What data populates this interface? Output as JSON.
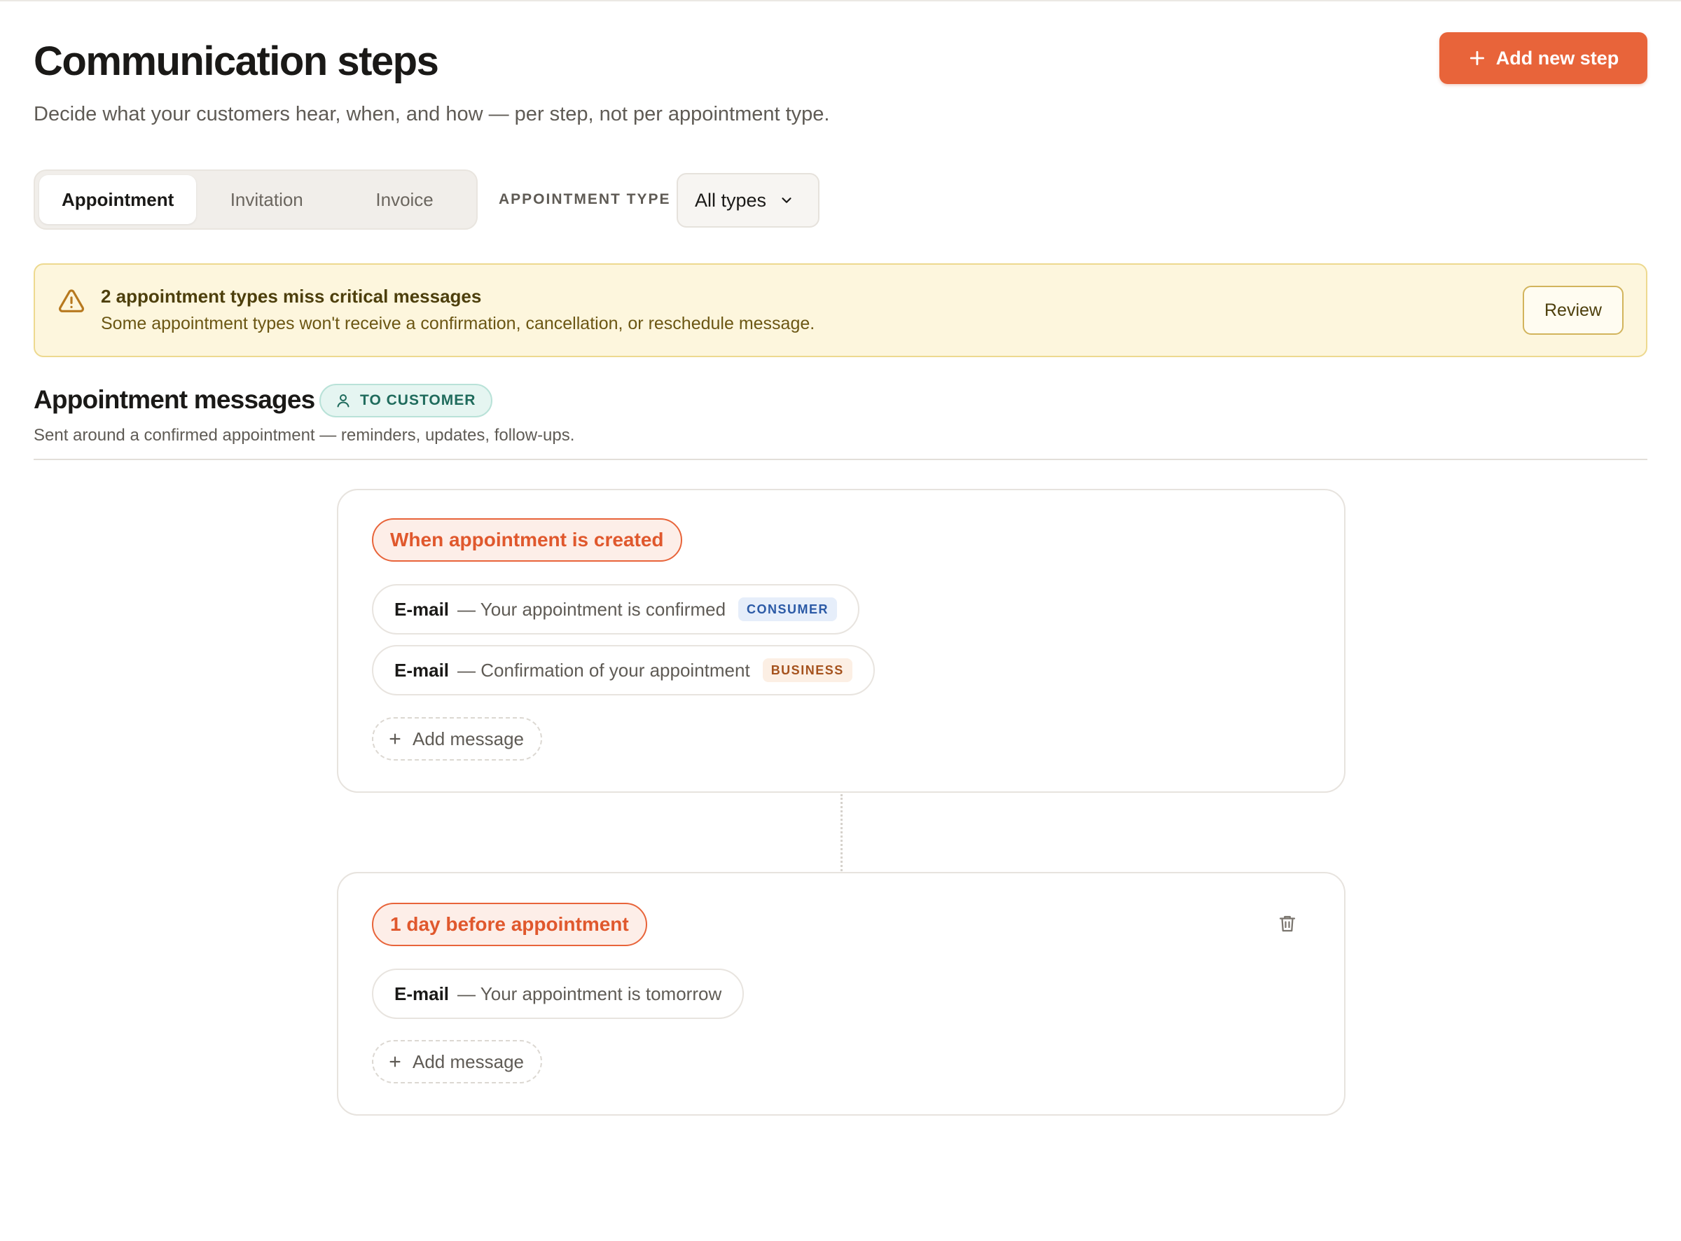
{
  "header": {
    "title": "Communication steps",
    "subtitle": "Decide what your customers hear, when, and how — per step, not per appointment type.",
    "add_step_label": "Add new step"
  },
  "tabs": [
    {
      "label": "Appointment",
      "active": true
    },
    {
      "label": "Invitation",
      "active": false
    },
    {
      "label": "Invoice",
      "active": false
    }
  ],
  "filter": {
    "label": "APPOINTMENT TYPE",
    "value": "All types"
  },
  "banner": {
    "title": "2 appointment types miss critical messages",
    "text": "Some appointment types won't receive a confirmation, cancellation, or reschedule message.",
    "action_label": "Review"
  },
  "section": {
    "title": "Appointment messages",
    "audience": "TO CUSTOMER",
    "description": "Sent around a confirmed appointment — reminders, updates, follow-ups."
  },
  "steps": [
    {
      "trigger": "When appointment is created",
      "messages": [
        {
          "channel": "E-mail",
          "subject": "— Your appointment is confirmed",
          "audience": "CONSUMER"
        },
        {
          "channel": "E-mail",
          "subject": "— Confirmation of your appointment",
          "audience": "BUSINESS"
        }
      ],
      "add_label": "Add message"
    },
    {
      "trigger": "1 day before appointment",
      "messages": [
        {
          "channel": "E-mail",
          "subject": "— Your appointment is tomorrow"
        }
      ],
      "add_label": "Add message"
    }
  ],
  "colors": {
    "accent": "#e8643a",
    "warning_bg": "#fdf6dd",
    "warning_border": "#edd98f",
    "audience_badge": "#1f6b5c",
    "consumer_tag": "#2b5aa6",
    "business_tag": "#a5521d"
  },
  "icons": [
    "plus-icon",
    "chevron-down-icon",
    "warning-triangle-icon",
    "user-icon",
    "trash-icon"
  ]
}
